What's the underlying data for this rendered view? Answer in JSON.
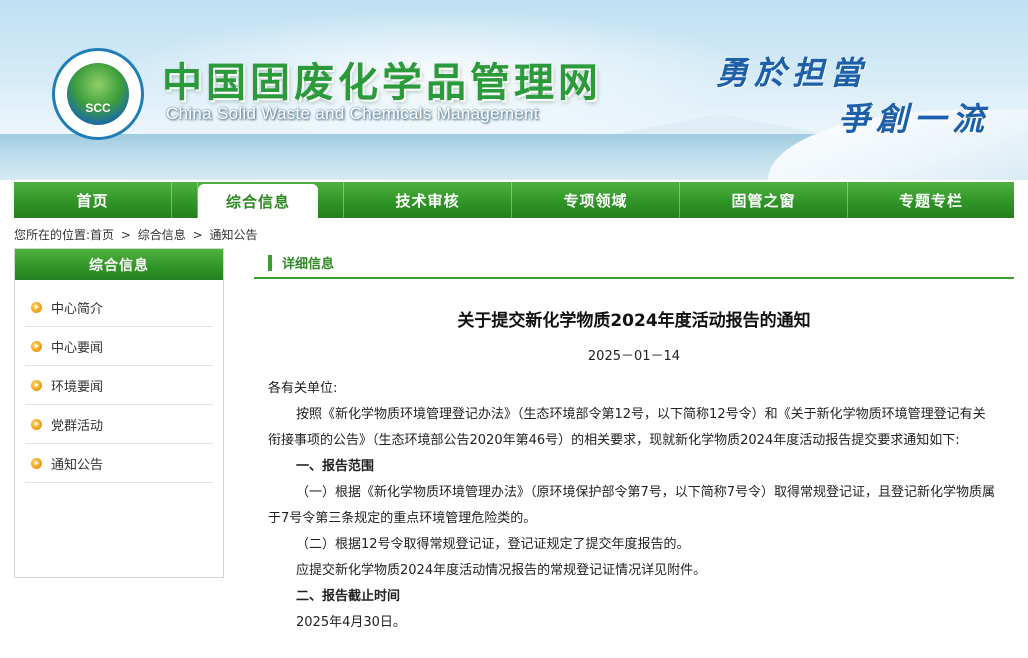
{
  "header": {
    "site_title": "中国固废化学品管理网",
    "site_subtitle": "China Solid Waste and Chemicals Management",
    "logo_text": "SCC",
    "slogan_line1": "勇於担當",
    "slogan_line2": "爭創一流"
  },
  "nav": {
    "items": [
      {
        "label": "首页",
        "active": false
      },
      {
        "label": "综合信息",
        "active": true
      },
      {
        "label": "技术审核",
        "active": false
      },
      {
        "label": "专项领域",
        "active": false
      },
      {
        "label": "固管之窗",
        "active": false
      },
      {
        "label": "专题专栏",
        "active": false
      }
    ]
  },
  "breadcrumb": {
    "prefix": "您所在的位置:",
    "items": [
      "首页",
      "综合信息",
      "通知公告"
    ],
    "separator": ">"
  },
  "sidebar": {
    "title": "综合信息",
    "items": [
      "中心简介",
      "中心要闻",
      "环境要闻",
      "党群活动",
      "通知公告"
    ]
  },
  "main": {
    "section_title": "详细信息",
    "article": {
      "title": "关于提交新化学物质2024年度活动报告的通知",
      "date": "2025－01－14",
      "salutation": "各有关单位:",
      "para1": "按照《新化学物质环境管理登记办法》（生态环境部令第12号，以下简称12号令）和《关于新化学物质环境管理登记有关衔接事项的公告》（生态环境部公告2020年第46号）的相关要求，现就新化学物质2024年度活动报告提交要求通知如下:",
      "heading1": "一、报告范围",
      "para2": "（一）根据《新化学物质环境管理办法》（原环境保护部令第7号，以下简称7号令）取得常规登记证，且登记新化学物质属于7号令第三条规定的重点环境管理危险类的。",
      "para3": "（二）根据12号令取得常规登记证，登记证规定了提交年度报告的。",
      "para4": "应提交新化学物质2024年度活动情况报告的常规登记证情况详见附件。",
      "heading2": "二、报告截止时间",
      "para5": "2025年4月30日。"
    }
  },
  "colors": {
    "nav_green": "#2f9527",
    "title_green": "#2b9a3b",
    "slogan_blue": "#1d5fa8",
    "bullet_orange": "#f2a418"
  }
}
